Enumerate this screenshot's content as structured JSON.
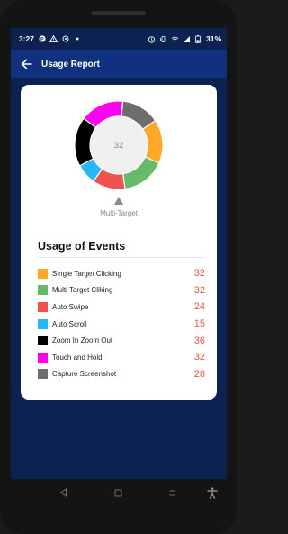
{
  "status_bar": {
    "time": "3:27",
    "battery_percent": "31%",
    "icons_left": [
      "p-badge-icon",
      "warning-icon",
      "target-icon",
      "dot-icon"
    ],
    "icons_right": [
      "alarm-icon",
      "vibrate-icon",
      "wifi-icon",
      "signal-icon",
      "battery-icon"
    ]
  },
  "app_bar": {
    "title": "Usage Report",
    "back_icon": "arrow-left-icon"
  },
  "chart_data": {
    "type": "pie",
    "center_value": "32",
    "selected_label": "Multi-Target",
    "slices": [
      {
        "name": "Single Target Clicking",
        "value": 32,
        "color": "#ffa726"
      },
      {
        "name": "Multi Target Cliking",
        "value": 32,
        "color": "#66bb6a"
      },
      {
        "name": "Auto Swipe",
        "value": 24,
        "color": "#ef5350"
      },
      {
        "name": "Auto Scroll",
        "value": 15,
        "color": "#29b6f6"
      },
      {
        "name": "Zoom In Zoom Out",
        "value": 36,
        "color": "#000000"
      },
      {
        "name": "Touch and Hold",
        "value": 32,
        "color": "#ff00ee"
      },
      {
        "name": "Capture Screenshot",
        "value": 28,
        "color": "#6d6d6d"
      }
    ]
  },
  "usage": {
    "title": "Usage of Events",
    "events": [
      {
        "label": "Single Target Clicking",
        "count": "32",
        "color": "#ffa726"
      },
      {
        "label": "Multi Target Cliking",
        "count": "32",
        "color": "#66bb6a"
      },
      {
        "label": "Auto Swipe",
        "count": "24",
        "color": "#ef5350"
      },
      {
        "label": "Auto Scroll",
        "count": "15",
        "color": "#29b6f6"
      },
      {
        "label": "Zoom In Zoom Out",
        "count": "36",
        "color": "#000000"
      },
      {
        "label": "Touch and Hold",
        "count": "32",
        "color": "#ff00ee"
      },
      {
        "label": "Capture Screenshot",
        "count": "28",
        "color": "#6d6d6d"
      }
    ]
  },
  "nav_bar": {
    "buttons": [
      "back-triangle-icon",
      "home-square-icon",
      "recents-lines-icon",
      "accessibility-icon"
    ]
  }
}
